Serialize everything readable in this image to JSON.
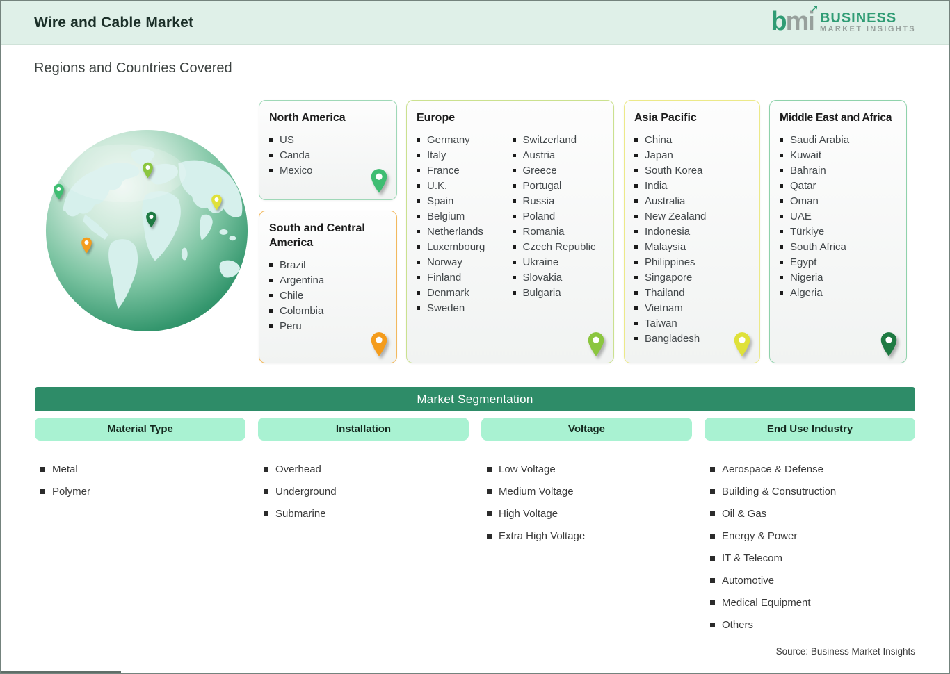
{
  "header": {
    "title": "Wire and Cable Market",
    "logo": {
      "mark_parts": [
        "b",
        "m",
        "i"
      ],
      "arrow_glyph": "➚",
      "line1": "BUSINESS",
      "line2": "MARKET INSIGHTS"
    }
  },
  "subtitle": "Regions and Countries Covered",
  "source": "Source: Business Market Insights",
  "colors": {
    "band": "#dff0e8",
    "bar": "#2e8c68",
    "pill": "#a9f2d2",
    "logo_green": "#2f9c74",
    "logo_gray": "#97a09c"
  },
  "regions": [
    {
      "name": "North America",
      "accent": "#9fd8b7",
      "pin": "#3fbd72",
      "countries": [
        "US",
        "Canda",
        "Mexico"
      ]
    },
    {
      "name": "South and Central America",
      "accent": "#f2b95e",
      "pin": "#f49c1c",
      "countries": [
        "Brazil",
        "Argentina",
        "Chile",
        "Colombia",
        "Peru"
      ]
    },
    {
      "name": "Europe",
      "accent": "#cbe18f",
      "pin": "#8bc63f",
      "countries_col1": [
        "Germany",
        "Italy",
        "France",
        "U.K.",
        "Spain",
        "Belgium",
        "Netherlands",
        "Luxembourg",
        "Norway",
        "Finland",
        "Denmark",
        "Sweden"
      ],
      "countries_col2": [
        "Switzerland",
        "Austria",
        "Greece",
        "Portugal",
        "Russia",
        "Poland",
        "Romania",
        "Czech Republic",
        "Ukraine",
        "Slovakia",
        "Bulgaria"
      ]
    },
    {
      "name": "Asia Pacific",
      "accent": "#ece989",
      "pin": "#dfe13a",
      "countries": [
        "China",
        "Japan",
        "South Korea",
        "India",
        "Australia",
        "New Zealand",
        "Indonesia",
        "Malaysia",
        "Philippines",
        "Singapore",
        "Thailand",
        "Vietnam",
        "Taiwan",
        "Bangladesh"
      ]
    },
    {
      "name": "Middle East and Africa",
      "accent": "#8fd2ab",
      "pin": "#1e7a42",
      "countries": [
        "Saudi Arabia",
        "Kuwait",
        "Bahrain",
        "Qatar",
        "Oman",
        "UAE",
        "Türkiye",
        "South Africa",
        "Egypt",
        "Nigeria",
        "Algeria"
      ]
    }
  ],
  "segmentation": {
    "title": "Market Segmentation",
    "columns": [
      {
        "label": "Material Type",
        "items": [
          "Metal",
          "Polymer"
        ]
      },
      {
        "label": "Installation",
        "items": [
          "Overhead",
          "Underground",
          "Submarine"
        ]
      },
      {
        "label": "Voltage",
        "items": [
          "Low Voltage",
          "Medium Voltage",
          "High Voltage",
          "Extra High Voltage"
        ]
      },
      {
        "label": "End Use Industry",
        "items": [
          "Aerospace & Defense",
          "Building & Consutruction",
          "Oil & Gas",
          "Energy & Power",
          "IT & Telecom",
          "Automotive",
          "Medical Equipment",
          "Others"
        ]
      }
    ]
  }
}
